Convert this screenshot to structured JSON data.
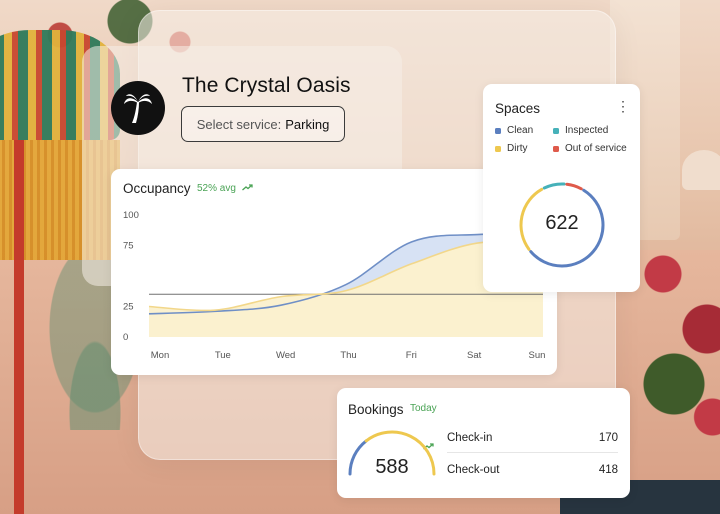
{
  "hotel": {
    "name": "The Crystal Oasis"
  },
  "service": {
    "prefix": "Select service:",
    "value": "Parking"
  },
  "occupancy": {
    "title": "Occupancy",
    "trend": "52% avg",
    "trend_icon": "trend-up-icon"
  },
  "spaces": {
    "title": "Spaces",
    "legend": [
      {
        "label": "Clean",
        "color": "#5b7fbf"
      },
      {
        "label": "Inspected",
        "color": "#46b1b9"
      },
      {
        "label": "Dirty",
        "color": "#eec84f"
      },
      {
        "label": "Out of service",
        "color": "#df5a4b"
      }
    ],
    "total": "622"
  },
  "bookings": {
    "title": "Bookings",
    "trend": "Today",
    "total": "588",
    "rows": [
      {
        "label": "Check-in",
        "value": "170"
      },
      {
        "label": "Check-out",
        "value": "418"
      }
    ]
  },
  "chart_data": [
    {
      "type": "area",
      "categories": [
        "Mon",
        "Tue",
        "Wed",
        "Thu",
        "Fri",
        "Sat",
        "Sun"
      ],
      "ylim": [
        0,
        100
      ],
      "yticks": [
        0,
        25,
        75,
        100
      ],
      "reference_line": 35,
      "series": [
        {
          "values": [
            25,
            22,
            33,
            38,
            60,
            77,
            77
          ],
          "color": "#f2d78a",
          "fill": "#fbf1cf"
        },
        {
          "values": [
            19,
            21,
            26,
            43,
            78,
            84,
            84
          ],
          "color": "#6f8fc6",
          "fill": "#d7e2f4"
        }
      ],
      "grid": false
    },
    {
      "type": "pie",
      "values": [
        {
          "label": "Clean",
          "value": 56,
          "color": "#5b7fbf"
        },
        {
          "label": "Dirty",
          "value": 28,
          "color": "#eec84f"
        },
        {
          "label": "Inspected",
          "value": 9,
          "color": "#46b1b9"
        },
        {
          "label": "Out of service",
          "value": 7,
          "color": "#df5a4b"
        }
      ]
    },
    {
      "type": "pie",
      "values": [
        {
          "label": "Check-in",
          "value": 170,
          "color": "#5b7fbf"
        },
        {
          "label": "Check-out",
          "value": 418,
          "color": "#eec84f"
        }
      ]
    }
  ]
}
